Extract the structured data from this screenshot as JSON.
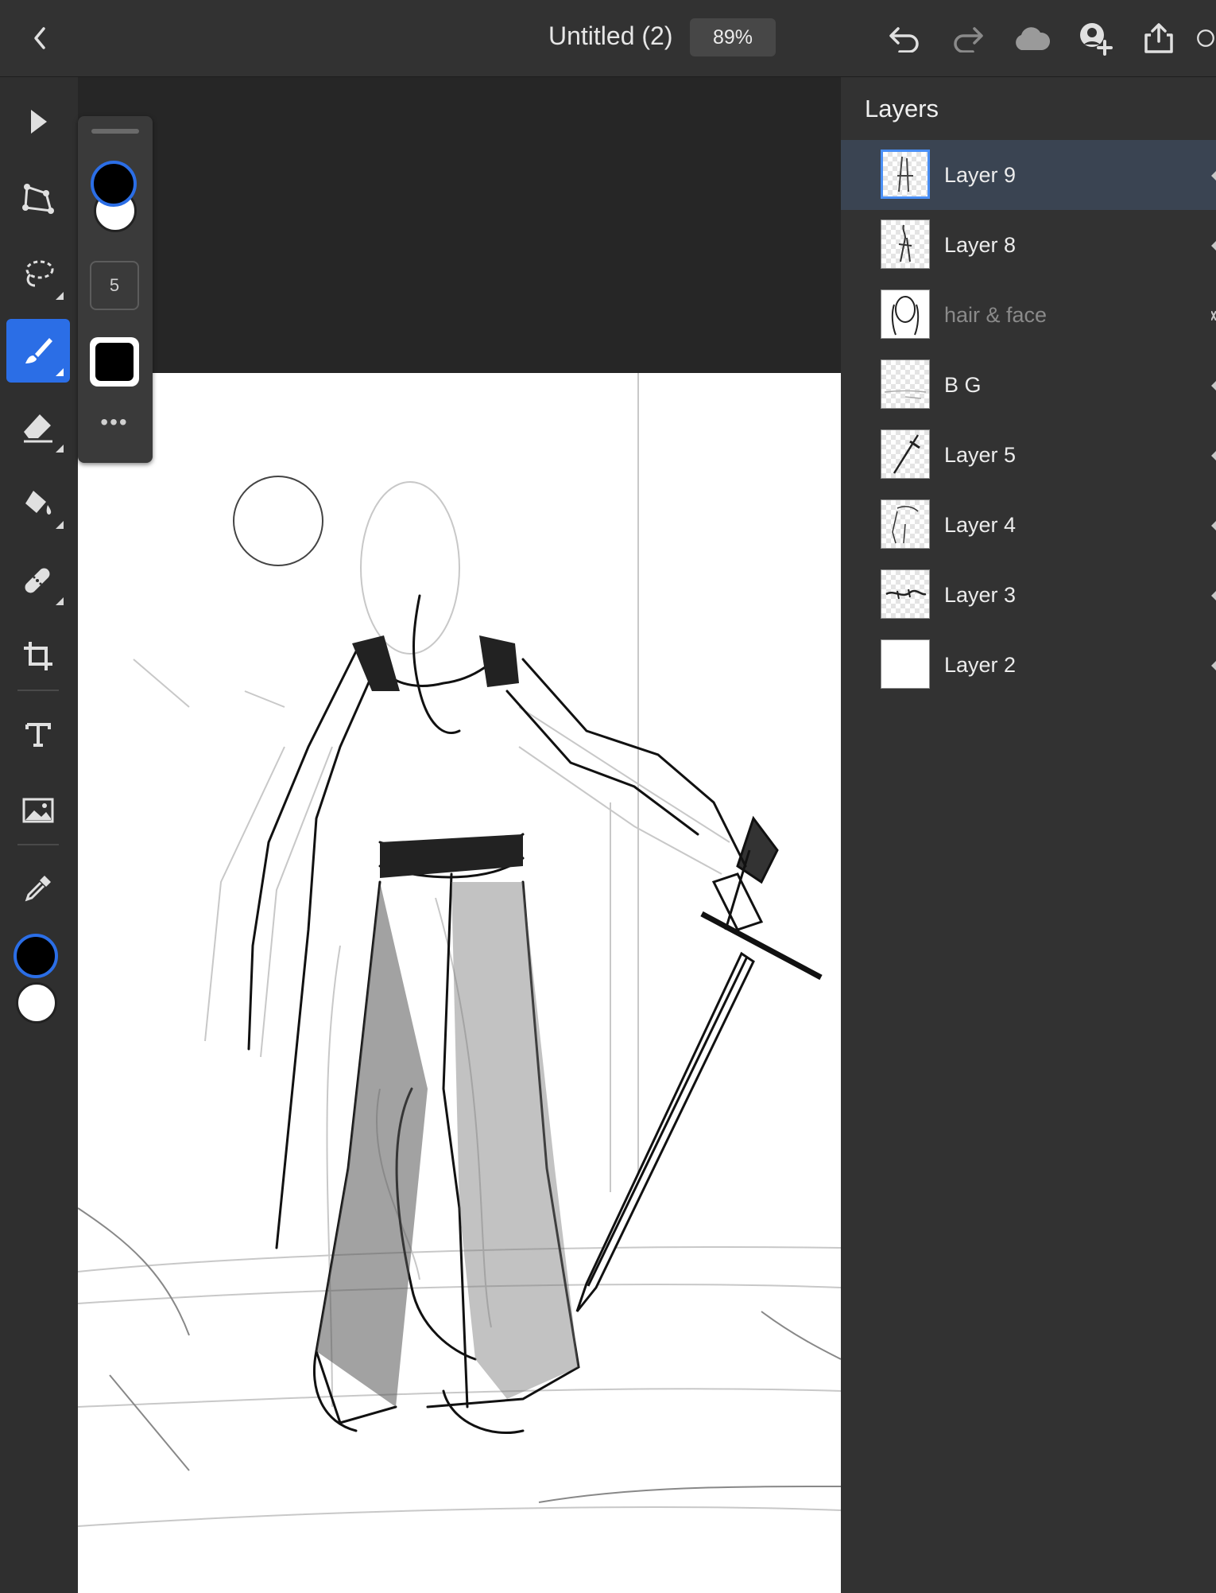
{
  "header": {
    "title": "Untitled (2)",
    "zoom": "89%",
    "icons": [
      "back-chevron-icon",
      "undo-icon",
      "redo-icon",
      "cloud-icon",
      "invite-user-icon",
      "share-icon",
      "help-icon"
    ]
  },
  "toolbar": {
    "tools": [
      "select-arrow-icon",
      "transform-icon",
      "lasso-icon",
      "brush-icon",
      "eraser-icon",
      "fill-bucket-icon",
      "heal-icon",
      "crop-icon",
      "text-icon",
      "image-icon",
      "eyedropper-icon"
    ],
    "active_tool": "brush",
    "primary_color": "#000000",
    "secondary_color": "#ffffff"
  },
  "brush_panel": {
    "size": "5",
    "more_label": "•••",
    "accent": "#2b6ee6"
  },
  "layers_panel": {
    "title": "Layers",
    "layers": [
      {
        "name": "Layer 9",
        "selected": true,
        "dim": false
      },
      {
        "name": "Layer 8",
        "selected": false,
        "dim": false
      },
      {
        "name": "hair & face",
        "selected": false,
        "dim": true
      },
      {
        "name": "B G",
        "selected": false,
        "dim": false
      },
      {
        "name": "Layer 5",
        "selected": false,
        "dim": false
      },
      {
        "name": "Layer 4",
        "selected": false,
        "dim": false
      },
      {
        "name": "Layer 3",
        "selected": false,
        "dim": false
      },
      {
        "name": "Layer 2",
        "selected": false,
        "dim": false
      }
    ]
  }
}
